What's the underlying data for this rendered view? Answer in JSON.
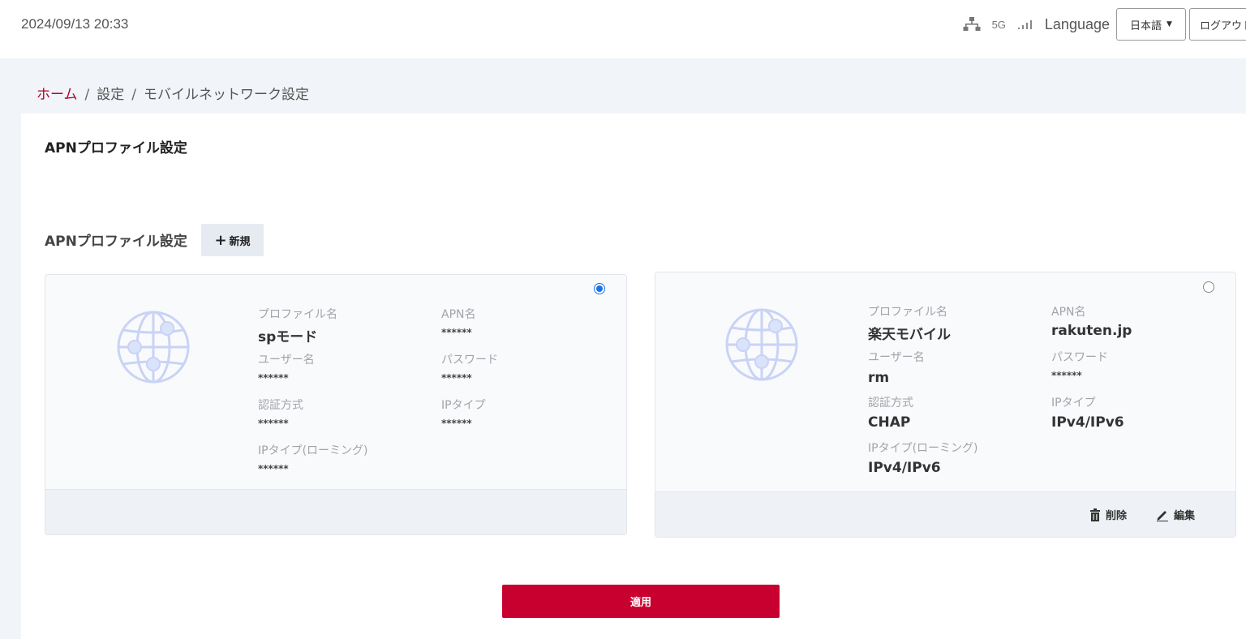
{
  "header": {
    "datetime": "2024/09/13 20:33",
    "network_type": "5G",
    "language_label": "Language",
    "language_selected": "日本語",
    "logout_label": "ログアウト"
  },
  "breadcrumb": {
    "home": "ホーム",
    "separator": "/",
    "settings": "設定",
    "current": "モバイルネットワーク設定"
  },
  "page": {
    "title": "APNプロファイル設定",
    "section_title": "APNプロファイル設定",
    "new_button": "新規",
    "apply_button": "適用"
  },
  "profiles": [
    {
      "selected": true,
      "profile_name_label": "プロファイル名",
      "profile_name": "spモード",
      "apn_label": "APN名",
      "apn": "******",
      "user_label": "ユーザー名",
      "user": "******",
      "password_label": "パスワード",
      "password": "******",
      "auth_label": "認証方式",
      "auth": "******",
      "ip_type_label": "IPタイプ",
      "ip_type": "******",
      "ip_roaming_label": "IPタイプ(ローミング)",
      "ip_roaming": "******"
    },
    {
      "selected": false,
      "profile_name_label": "プロファイル名",
      "profile_name": "楽天モバイル",
      "apn_label": "APN名",
      "apn": "rakuten.jp",
      "user_label": "ユーザー名",
      "user": "rm",
      "password_label": "パスワード",
      "password": "******",
      "auth_label": "認証方式",
      "auth": "CHAP",
      "ip_type_label": "IPタイプ",
      "ip_type": "IPv4/IPv6",
      "ip_roaming_label": "IPタイプ(ローミング)",
      "ip_roaming": "IPv4/IPv6",
      "delete_label": "削除",
      "edit_label": "編集"
    }
  ],
  "colors": {
    "accent": "#c8002f",
    "breadcrumb_home": "#b5002f",
    "radio_selected": "#1a73e8",
    "globe": "#c9d3f5"
  }
}
